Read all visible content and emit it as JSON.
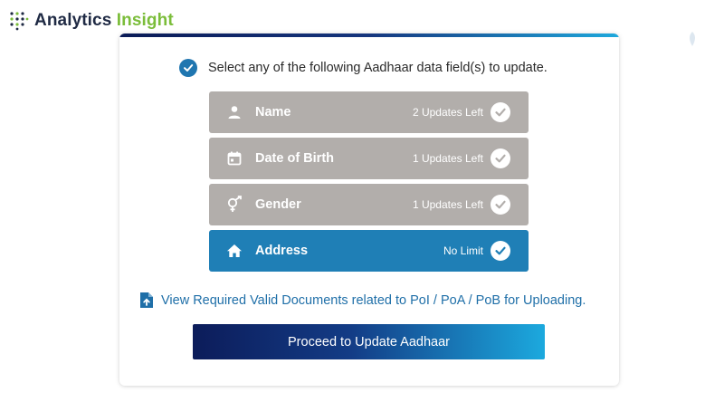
{
  "watermark": {
    "brand_main": "Analytics",
    "brand_accent": "Insight"
  },
  "form": {
    "prompt": "Select any of the following Aadhaar data field(s) to update.",
    "fields": [
      {
        "label": "Name",
        "status": "2 Updates Left",
        "icon": "person-icon",
        "selected": false
      },
      {
        "label": "Date of Birth",
        "status": "1 Updates Left",
        "icon": "calendar-icon",
        "selected": false
      },
      {
        "label": "Gender",
        "status": "1 Updates Left",
        "icon": "gender-icon",
        "selected": false
      },
      {
        "label": "Address",
        "status": "No Limit",
        "icon": "home-icon",
        "selected": true
      }
    ],
    "docs_link": "View Required Valid Documents related to PoI / PoA / PoB for Uploading.",
    "proceed_label": "Proceed to Update Aadhaar"
  },
  "colors": {
    "field_default": "#b2aeab",
    "field_selected": "#1f7fb6",
    "link": "#1f6fa8",
    "check_grey": "#b2aeab",
    "check_blue": "#1f7fb6"
  }
}
